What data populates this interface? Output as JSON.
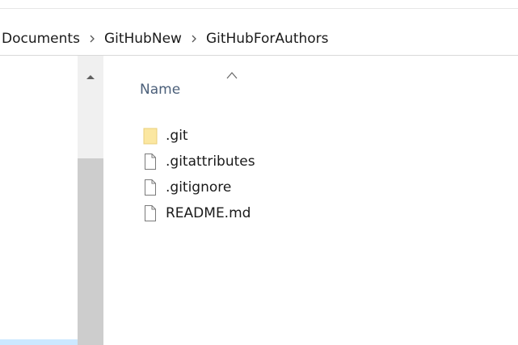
{
  "breadcrumb": {
    "items": [
      "Documents",
      "GitHubNew",
      "GitHubForAuthors"
    ],
    "separator_icon": "chevron-right-icon"
  },
  "file_list": {
    "column_header": "Name",
    "sort_icon": "sort-ascending-icon",
    "items": [
      {
        "name": ".git",
        "type": "folder",
        "icon": "folder-icon"
      },
      {
        "name": ".gitattributes",
        "type": "file",
        "icon": "file-icon"
      },
      {
        "name": ".gitignore",
        "type": "file",
        "icon": "file-icon"
      },
      {
        "name": "README.md",
        "type": "file",
        "icon": "file-icon"
      }
    ]
  },
  "scrollbar": {
    "up_icon": "scroll-up-arrow-icon"
  },
  "colors": {
    "folder": "#fbe7a1",
    "header_text": "#4c607a",
    "scroll_thumb": "#cdcdcd",
    "scroll_track": "#f0f0f0",
    "nav_selected": "#cce8ff"
  }
}
